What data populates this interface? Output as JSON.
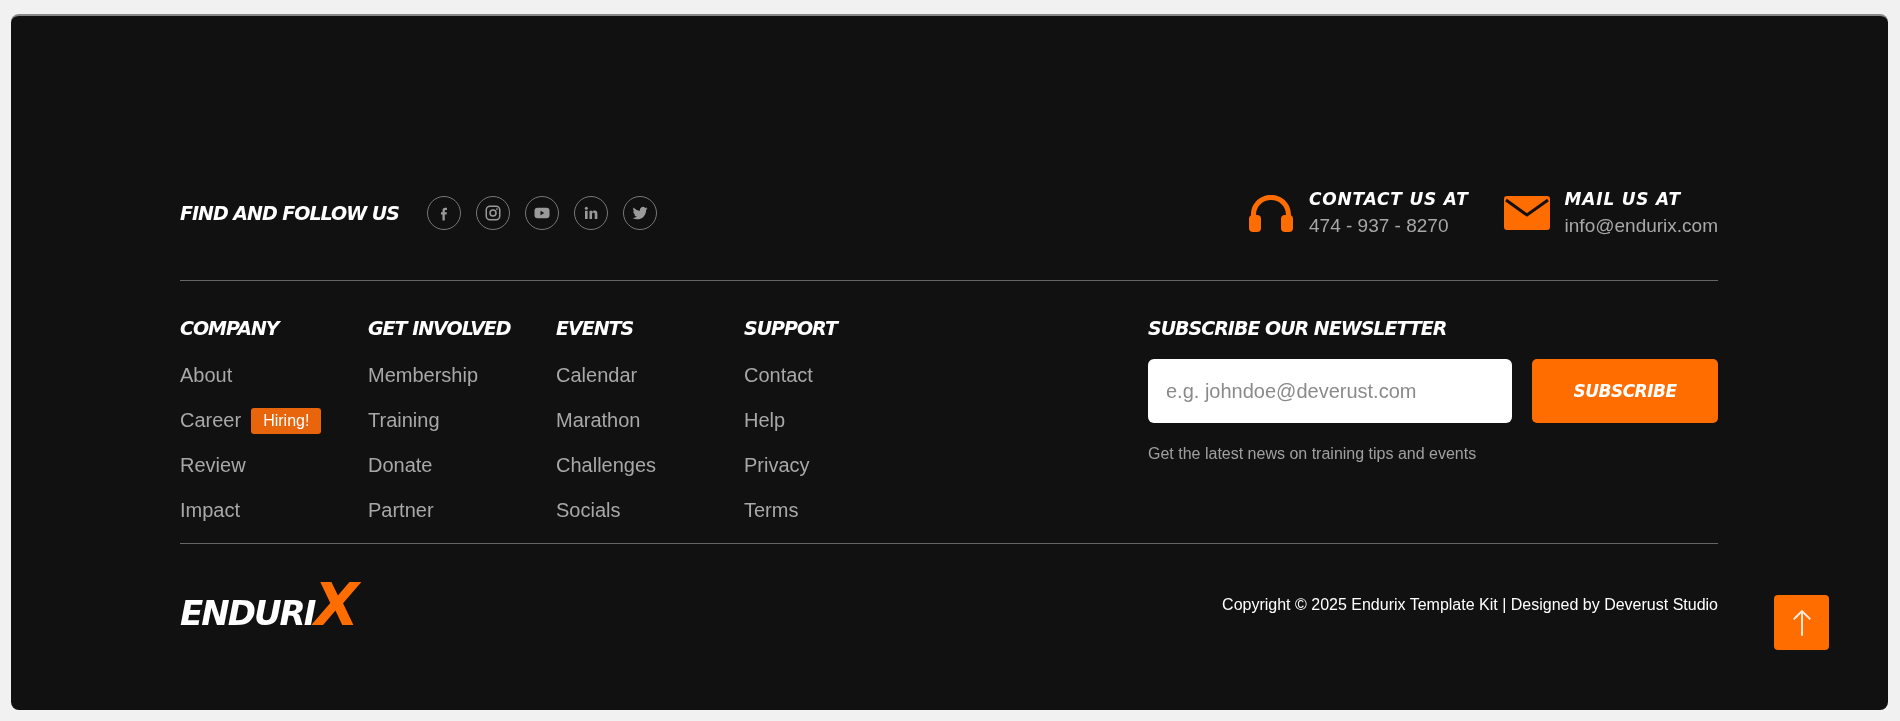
{
  "follow": {
    "title": "FIND AND FOLLOW US"
  },
  "contacts": [
    {
      "kind": "phone",
      "label": "CONTACT US AT",
      "value": "474 - 937 - 8270"
    },
    {
      "kind": "mail",
      "label": "MAIL US AT",
      "value": "info@endurix.com"
    }
  ],
  "columns": [
    {
      "title": "COMPANY",
      "links": [
        {
          "label": "About"
        },
        {
          "label": "Career",
          "badge": "Hiring!"
        },
        {
          "label": "Review"
        },
        {
          "label": "Impact"
        }
      ]
    },
    {
      "title": "GET INVOLVED",
      "links": [
        {
          "label": "Membership"
        },
        {
          "label": "Training"
        },
        {
          "label": "Donate"
        },
        {
          "label": "Partner"
        }
      ]
    },
    {
      "title": "EVENTS",
      "links": [
        {
          "label": "Calendar"
        },
        {
          "label": "Marathon"
        },
        {
          "label": "Challenges"
        },
        {
          "label": "Socials"
        }
      ]
    },
    {
      "title": "SUPPORT",
      "links": [
        {
          "label": "Contact"
        },
        {
          "label": "Help"
        },
        {
          "label": "Privacy"
        },
        {
          "label": "Terms"
        }
      ]
    }
  ],
  "newsletter": {
    "title": "SUBSCRIBE OUR NEWSLETTER",
    "placeholder": "e.g. johndoe@deverust.com",
    "button": "SUBSCRIBE",
    "note": "Get the latest news on training tips and events"
  },
  "logo": {
    "text": "ENDURI",
    "accent": "X"
  },
  "copyright": "Copyright © 2025 Endurix Template Kit | Designed by Deverust Studio"
}
